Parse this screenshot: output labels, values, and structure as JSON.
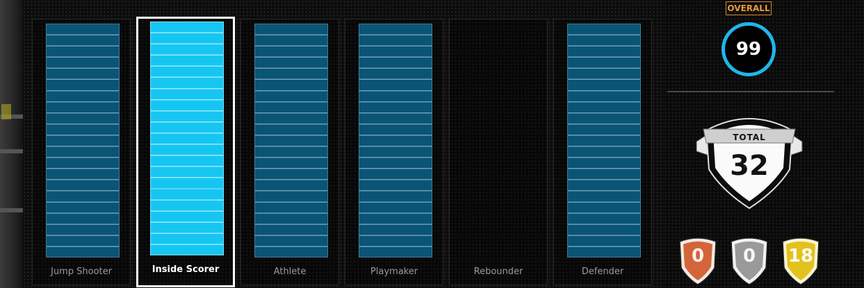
{
  "categories": [
    {
      "label": "Jump Shooter",
      "state": "filled"
    },
    {
      "label": "Inside Scorer",
      "state": "selected"
    },
    {
      "label": "Athlete",
      "state": "filled"
    },
    {
      "label": "Playmaker",
      "state": "filled"
    },
    {
      "label": "Rebounder",
      "state": "empty"
    },
    {
      "label": "Defender",
      "state": "filled"
    }
  ],
  "segments_per_bar": 21,
  "overall": {
    "label": "OVERALL",
    "value": "99"
  },
  "total": {
    "label": "TOTAL",
    "value": "32"
  },
  "badges": [
    {
      "tier": "bronze",
      "count": "0",
      "color": "#d4643a"
    },
    {
      "tier": "silver",
      "count": "0",
      "color": "#9a9a9a"
    },
    {
      "tier": "gold",
      "count": "18",
      "color": "#e3c21e"
    }
  ],
  "colors": {
    "bar_fill": "#0a5475",
    "bar_selected": "#16c6f2",
    "overall_ring": "#1eb7ec",
    "overall_tag": "#e89a3a"
  }
}
